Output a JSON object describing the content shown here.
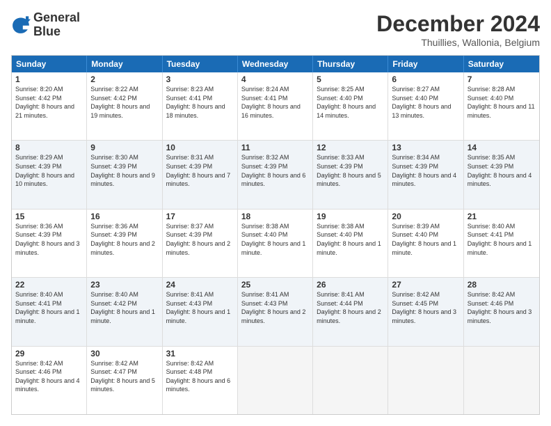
{
  "logo": {
    "line1": "General",
    "line2": "Blue"
  },
  "title": "December 2024",
  "subtitle": "Thuillies, Wallonia, Belgium",
  "days": [
    "Sunday",
    "Monday",
    "Tuesday",
    "Wednesday",
    "Thursday",
    "Friday",
    "Saturday"
  ],
  "rows": [
    [
      {
        "day": "1",
        "sunrise": "8:20 AM",
        "sunset": "4:42 PM",
        "daylight": "8 hours and 21 minutes."
      },
      {
        "day": "2",
        "sunrise": "8:22 AM",
        "sunset": "4:42 PM",
        "daylight": "8 hours and 19 minutes."
      },
      {
        "day": "3",
        "sunrise": "8:23 AM",
        "sunset": "4:41 PM",
        "daylight": "8 hours and 18 minutes."
      },
      {
        "day": "4",
        "sunrise": "8:24 AM",
        "sunset": "4:41 PM",
        "daylight": "8 hours and 16 minutes."
      },
      {
        "day": "5",
        "sunrise": "8:25 AM",
        "sunset": "4:40 PM",
        "daylight": "8 hours and 14 minutes."
      },
      {
        "day": "6",
        "sunrise": "8:27 AM",
        "sunset": "4:40 PM",
        "daylight": "8 hours and 13 minutes."
      },
      {
        "day": "7",
        "sunrise": "8:28 AM",
        "sunset": "4:40 PM",
        "daylight": "8 hours and 11 minutes."
      }
    ],
    [
      {
        "day": "8",
        "sunrise": "8:29 AM",
        "sunset": "4:39 PM",
        "daylight": "8 hours and 10 minutes."
      },
      {
        "day": "9",
        "sunrise": "8:30 AM",
        "sunset": "4:39 PM",
        "daylight": "8 hours and 9 minutes."
      },
      {
        "day": "10",
        "sunrise": "8:31 AM",
        "sunset": "4:39 PM",
        "daylight": "8 hours and 7 minutes."
      },
      {
        "day": "11",
        "sunrise": "8:32 AM",
        "sunset": "4:39 PM",
        "daylight": "8 hours and 6 minutes."
      },
      {
        "day": "12",
        "sunrise": "8:33 AM",
        "sunset": "4:39 PM",
        "daylight": "8 hours and 5 minutes."
      },
      {
        "day": "13",
        "sunrise": "8:34 AM",
        "sunset": "4:39 PM",
        "daylight": "8 hours and 4 minutes."
      },
      {
        "day": "14",
        "sunrise": "8:35 AM",
        "sunset": "4:39 PM",
        "daylight": "8 hours and 4 minutes."
      }
    ],
    [
      {
        "day": "15",
        "sunrise": "8:36 AM",
        "sunset": "4:39 PM",
        "daylight": "8 hours and 3 minutes."
      },
      {
        "day": "16",
        "sunrise": "8:36 AM",
        "sunset": "4:39 PM",
        "daylight": "8 hours and 2 minutes."
      },
      {
        "day": "17",
        "sunrise": "8:37 AM",
        "sunset": "4:39 PM",
        "daylight": "8 hours and 2 minutes."
      },
      {
        "day": "18",
        "sunrise": "8:38 AM",
        "sunset": "4:40 PM",
        "daylight": "8 hours and 1 minute."
      },
      {
        "day": "19",
        "sunrise": "8:38 AM",
        "sunset": "4:40 PM",
        "daylight": "8 hours and 1 minute."
      },
      {
        "day": "20",
        "sunrise": "8:39 AM",
        "sunset": "4:40 PM",
        "daylight": "8 hours and 1 minute."
      },
      {
        "day": "21",
        "sunrise": "8:40 AM",
        "sunset": "4:41 PM",
        "daylight": "8 hours and 1 minute."
      }
    ],
    [
      {
        "day": "22",
        "sunrise": "8:40 AM",
        "sunset": "4:41 PM",
        "daylight": "8 hours and 1 minute."
      },
      {
        "day": "23",
        "sunrise": "8:40 AM",
        "sunset": "4:42 PM",
        "daylight": "8 hours and 1 minute."
      },
      {
        "day": "24",
        "sunrise": "8:41 AM",
        "sunset": "4:43 PM",
        "daylight": "8 hours and 1 minute."
      },
      {
        "day": "25",
        "sunrise": "8:41 AM",
        "sunset": "4:43 PM",
        "daylight": "8 hours and 2 minutes."
      },
      {
        "day": "26",
        "sunrise": "8:41 AM",
        "sunset": "4:44 PM",
        "daylight": "8 hours and 2 minutes."
      },
      {
        "day": "27",
        "sunrise": "8:42 AM",
        "sunset": "4:45 PM",
        "daylight": "8 hours and 3 minutes."
      },
      {
        "day": "28",
        "sunrise": "8:42 AM",
        "sunset": "4:46 PM",
        "daylight": "8 hours and 3 minutes."
      }
    ],
    [
      {
        "day": "29",
        "sunrise": "8:42 AM",
        "sunset": "4:46 PM",
        "daylight": "8 hours and 4 minutes."
      },
      {
        "day": "30",
        "sunrise": "8:42 AM",
        "sunset": "4:47 PM",
        "daylight": "8 hours and 5 minutes."
      },
      {
        "day": "31",
        "sunrise": "8:42 AM",
        "sunset": "4:48 PM",
        "daylight": "8 hours and 6 minutes."
      },
      null,
      null,
      null,
      null
    ]
  ]
}
